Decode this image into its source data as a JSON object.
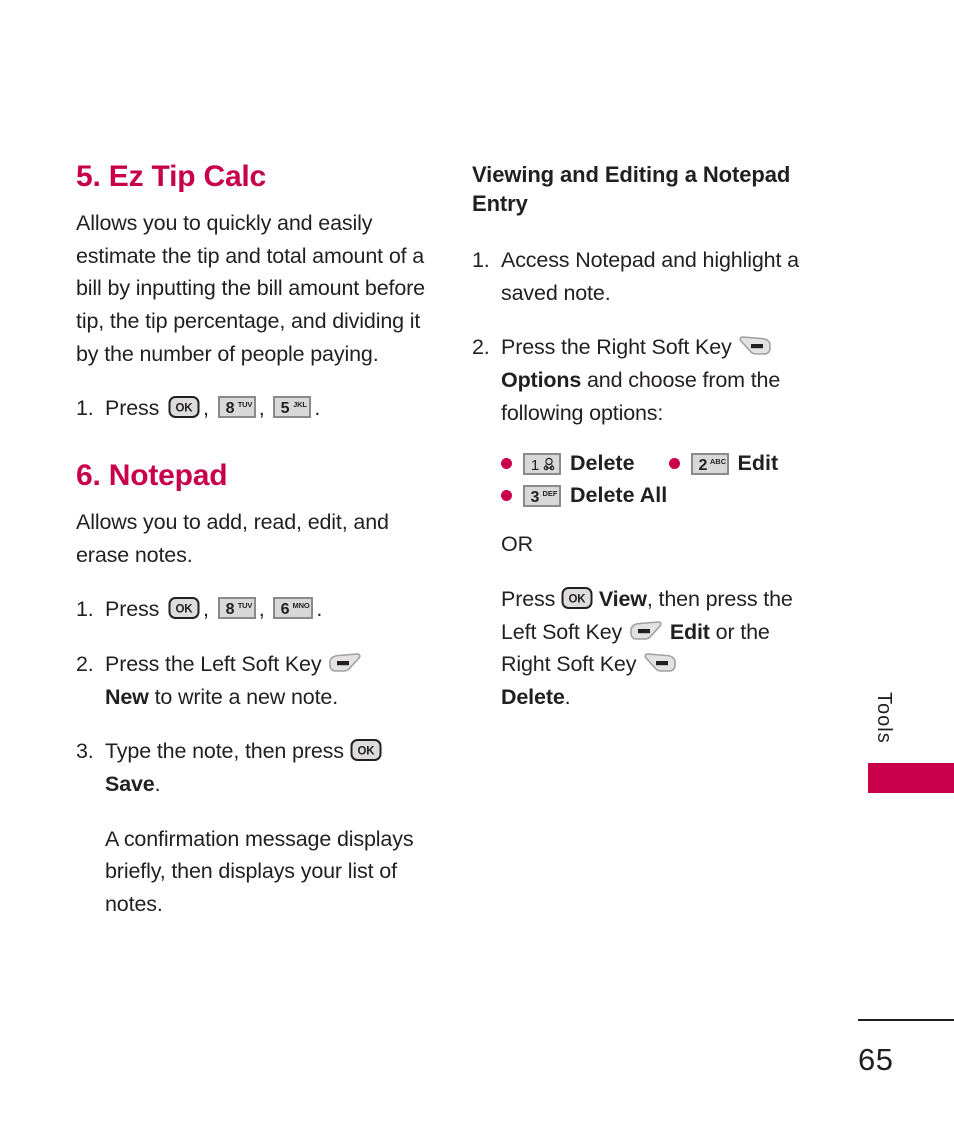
{
  "page": {
    "number": "65",
    "side_tab": "Tools",
    "accent_color": "#c8004b",
    "text_color": "#231f20"
  },
  "left_column": {
    "section5": {
      "heading": "5. Ez Tip Calc",
      "description": "Allows you to quickly and easily estimate the tip and total amount of a bill by inputting the bill amount before tip, the tip percentage, and dividing it by the number of people paying.",
      "step1": {
        "number": "1.",
        "text_before": "Press",
        "keys": [
          "ok-key",
          "8-tuv-key",
          "5-jkl-key"
        ],
        "separator": ",",
        "period": "."
      }
    },
    "section6": {
      "heading": "6. Notepad",
      "description": "Allows you to add, read, edit, and erase notes.",
      "step1": {
        "number": "1.",
        "text_before": "Press",
        "keys": [
          "ok-key",
          "8-tuv-key",
          "6-mno-key"
        ],
        "separator": ",",
        "period": "."
      },
      "step2": {
        "number": "2.",
        "text_before": "Press the Left Soft Key",
        "key": "left-soft-key",
        "bold_label": "New",
        "text_after": "to write a new note."
      },
      "step3": {
        "number": "3.",
        "text_before": "Type the note, then press",
        "key": "ok-key",
        "bold_label": "Save",
        "text_after": "."
      },
      "note": "A confirmation message displays briefly, then displays your list of notes."
    }
  },
  "right_column": {
    "heading": "Viewing and Editing a Notepad Entry",
    "step1": {
      "number": "1.",
      "text": "Access Notepad and highlight a saved note."
    },
    "step2": {
      "number": "2.",
      "text_before": "Press the Right Soft Key",
      "key": "right-soft-key",
      "bold_label": "Options",
      "text_after": "and choose from the following options:"
    },
    "options": [
      {
        "key": "1-voicemail-key",
        "label": "Delete"
      },
      {
        "key": "2-abc-key",
        "label": "Edit"
      },
      {
        "key": "3-def-key",
        "label": "Delete All"
      }
    ],
    "or_text": "OR",
    "alt": {
      "text_before": "Press",
      "key_ok": "ok-key",
      "bold_view": "View",
      "text_mid1": ", then press the Left Soft Key",
      "key_left": "left-soft-key",
      "bold_edit": "Edit",
      "text_mid2": "or the Right Soft Key",
      "key_right": "right-soft-key",
      "bold_delete": "Delete",
      "text_end": "."
    }
  },
  "key_glyphs": {
    "ok": "OK",
    "k1_digit": "1",
    "k2_digit": "2",
    "k2_letters": "ABC",
    "k3_digit": "3",
    "k3_letters": "DEF",
    "k5_digit": "5",
    "k5_letters": "JKL",
    "k6_digit": "6",
    "k6_letters": "MNO",
    "k8_digit": "8",
    "k8_letters": "TUV"
  }
}
